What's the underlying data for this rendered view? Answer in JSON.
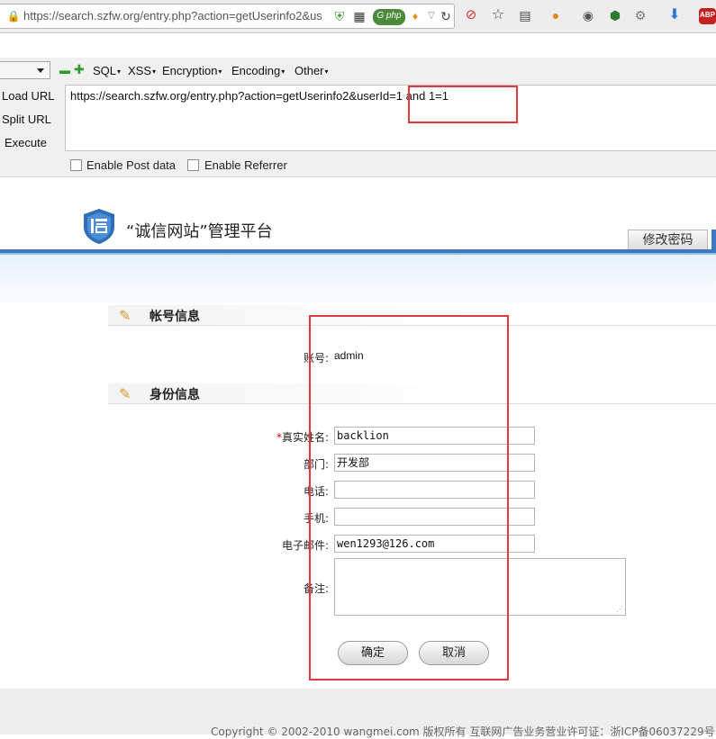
{
  "browser": {
    "url": "https://search.szfw.org/entry.php?action=getUserinfo2&us",
    "url_domain_bold": "szfw.org",
    "toolbar_icons": [
      "lock-icon",
      "shield-check-icon",
      "qr-code-icon",
      "php-badge-icon",
      "location-icon",
      "dropdown-icon",
      "reload-icon",
      "no-entry-icon",
      "star-icon",
      "reader-icon",
      "extension-icon",
      "palette-icon",
      "ghostery-icon",
      "settings-icon",
      "download-icon",
      "adblock-icon"
    ],
    "abp_label": "ABP"
  },
  "hackbar": {
    "menus": [
      "SQL",
      "XSS",
      "Encryption",
      "Encoding",
      "Other"
    ],
    "buttons": {
      "load": "Load URL",
      "split": "Split URL",
      "execute": "Execute"
    },
    "url_value": "https://search.szfw.org/entry.php?action=getUserinfo2&userId=1 and 1=1",
    "enable_post": "Enable Post data",
    "enable_referrer": "Enable Referrer"
  },
  "header": {
    "title": "“诚信网站”管理平台",
    "tab_change_password": "修改密码"
  },
  "sections": {
    "account": {
      "title": "帐号信息",
      "account_label": "账号:",
      "account_value": "admin"
    },
    "identity": {
      "title": "身份信息",
      "required_mark": "*",
      "name_label": "真实姓名:",
      "name_value": "backlion",
      "dept_label": "部门:",
      "dept_value": "开发部",
      "phone_label": "电话:",
      "phone_value": "",
      "mobile_label": "手机:",
      "mobile_value": "",
      "email_label": "电子邮件:",
      "email_value": "wen1293@126.com",
      "remark_label": "备注:",
      "remark_value": ""
    }
  },
  "actions": {
    "confirm": "确定",
    "cancel": "取消"
  },
  "footer": {
    "text": "Copyright © 2002-2010 wangmei.com 版权所有 互联网广告业务营业许可证：浙ICP备06037229号"
  },
  "colors": {
    "accent": "#3a79c0",
    "highlight": "#e0393e",
    "required": "#dd0000"
  }
}
